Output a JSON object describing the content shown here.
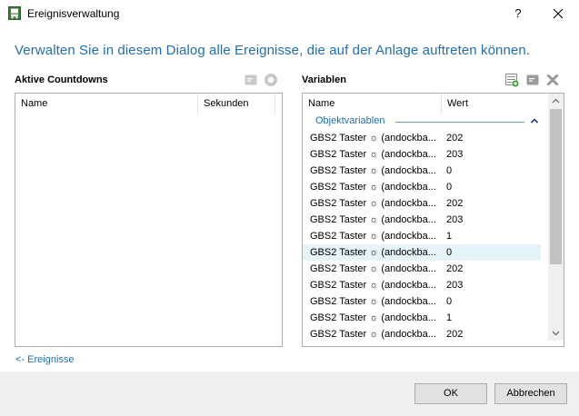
{
  "window": {
    "title": "Ereignisverwaltung",
    "help_label": "?"
  },
  "headline": "Verwalten Sie in diesem Dialog alle Ereignisse, die auf der Anlage auftreten können.",
  "countdowns": {
    "title": "Aktive Countdowns",
    "columns": [
      "Name",
      "Sekunden"
    ]
  },
  "variables": {
    "title": "Variablen",
    "columns": [
      "Name",
      "Wert"
    ],
    "group_label": "Objektvariablen",
    "rows": [
      {
        "name": "GBS2 Taster ☼ (andockba...",
        "value": "202"
      },
      {
        "name": "GBS2 Taster ☼ (andockba...",
        "value": "203"
      },
      {
        "name": "GBS2 Taster ☼ (andockba...",
        "value": "0"
      },
      {
        "name": "GBS2 Taster ☼ (andockba...",
        "value": "0"
      },
      {
        "name": "GBS2 Taster ☼ (andockba...",
        "value": "202"
      },
      {
        "name": "GBS2 Taster ☼ (andockba...",
        "value": "203"
      },
      {
        "name": "GBS2 Taster ☼ (andockba...",
        "value": "1"
      },
      {
        "name": "GBS2 Taster ☼ (andockba...",
        "value": "0"
      },
      {
        "name": "GBS2 Taster ☼ (andockba...",
        "value": "202"
      },
      {
        "name": "GBS2 Taster ☼ (andockba...",
        "value": "203"
      },
      {
        "name": "GBS2 Taster ☼ (andockba...",
        "value": "0"
      },
      {
        "name": "GBS2 Taster ☼ (andockba...",
        "value": "1"
      },
      {
        "name": "GBS2 Taster ☼ (andockba...",
        "value": "202"
      }
    ],
    "selected_index": 7
  },
  "events_link": "<- Ereignisse",
  "buttons": {
    "ok": "OK",
    "cancel": "Abbrechen"
  },
  "colors": {
    "accent": "#1f6fb2",
    "selection": "#e5f3fb",
    "footer": "#f0f0f0"
  },
  "icons": {
    "app": "train-icon",
    "countdown_tools": [
      "edit-icon",
      "stop-icon"
    ],
    "variable_tools": [
      "add-variable-icon",
      "edit-icon",
      "delete-icon"
    ]
  }
}
